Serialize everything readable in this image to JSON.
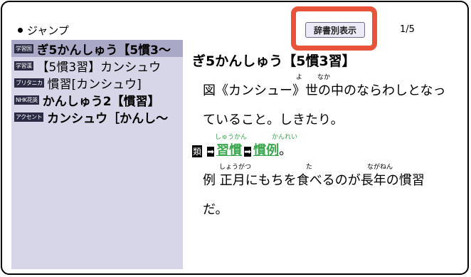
{
  "header": {
    "jump_label": "ジャンプ",
    "tab_button_label": "辞書別表示",
    "page_indicator": "1/5"
  },
  "sidebar": {
    "items": [
      {
        "badge": "学習国",
        "text": "ぎ5かんしゅう【5慣3～"
      },
      {
        "badge": "学習漢",
        "text": "【5慣3習】カンシュウ"
      },
      {
        "badge": "ブリタニカ",
        "text": "慣習[カンシュウ]"
      },
      {
        "badge": "NHK花英",
        "text": "かんしゅう2【慣習】"
      },
      {
        "badge": "アクセント",
        "text": "カンシュウ［かんし～"
      }
    ]
  },
  "entry": {
    "headword": "ぎ5かんしゅう【5慣3習】",
    "line1": "図《カンシュー》世の中のならわしとなっ",
    "line2": "ていること。しきたり。",
    "line3_label": "類",
    "line3_a": "習慣",
    "line3_b": "慣例",
    "line3_end": "。",
    "line4": "例 正月にもちを食べるのが長年の慣習",
    "line5": "だ。",
    "ruby_yo": "よ",
    "ruby_naka": "なか",
    "ruby_shuukan": "しゅうかん",
    "ruby_kanrei": "かんれい",
    "ruby_shougatsu": "しょうがつ",
    "ruby_ta": "た",
    "ruby_naganen": "ながねん"
  }
}
